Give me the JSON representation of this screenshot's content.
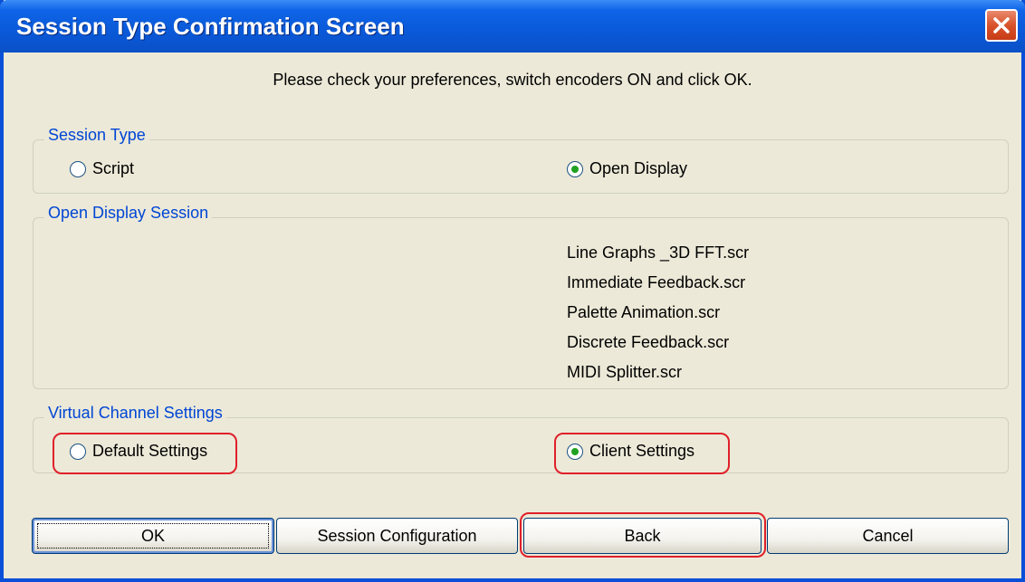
{
  "window": {
    "title": "Session Type Confirmation Screen"
  },
  "instruction": "Please check your preferences, switch encoders ON and click OK.",
  "session_type": {
    "label": "Session Type",
    "options": [
      {
        "label": "Script",
        "checked": false
      },
      {
        "label": "Open Display",
        "checked": true
      }
    ]
  },
  "open_display_session": {
    "label": "Open Display Session",
    "scripts": [
      "Line Graphs _3D FFT.scr",
      "Immediate Feedback.scr",
      "Palette Animation.scr",
      "Discrete Feedback.scr",
      "MIDI Splitter.scr"
    ]
  },
  "virtual_channel": {
    "label": "Virtual Channel Settings",
    "options": [
      {
        "label": "Default Settings",
        "checked": false
      },
      {
        "label": "Client Settings",
        "checked": true
      }
    ]
  },
  "buttons": {
    "ok": "OK",
    "session_configuration": "Session Configuration",
    "back": "Back",
    "cancel": "Cancel"
  },
  "colors": {
    "titlebar": "#0A59D8",
    "group_label": "#0046D5",
    "highlight": "#E0202A",
    "radio_dot": "#21A121"
  }
}
